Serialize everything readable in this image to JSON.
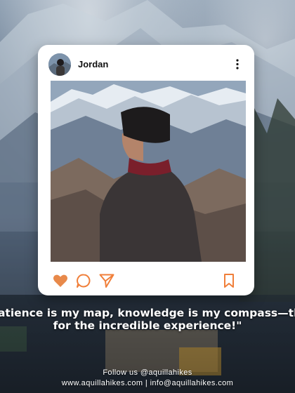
{
  "post": {
    "username": "Jordan"
  },
  "icons": {
    "more": "more-vertical-icon",
    "like": "heart-icon",
    "comment": "comment-icon",
    "share": "send-icon",
    "save": "bookmark-icon"
  },
  "colors": {
    "like_active": "#e8894a",
    "icon": "#f07f3a"
  },
  "caption": {
    "line1": "Patience is my map, knowledge is my compass—thank u",
    "line2": "for the incredible experience!\""
  },
  "footer": {
    "follow": "Follow us @aquillahikes",
    "contact": "www.aquillahikes.com | info@aquillahikes.com"
  }
}
